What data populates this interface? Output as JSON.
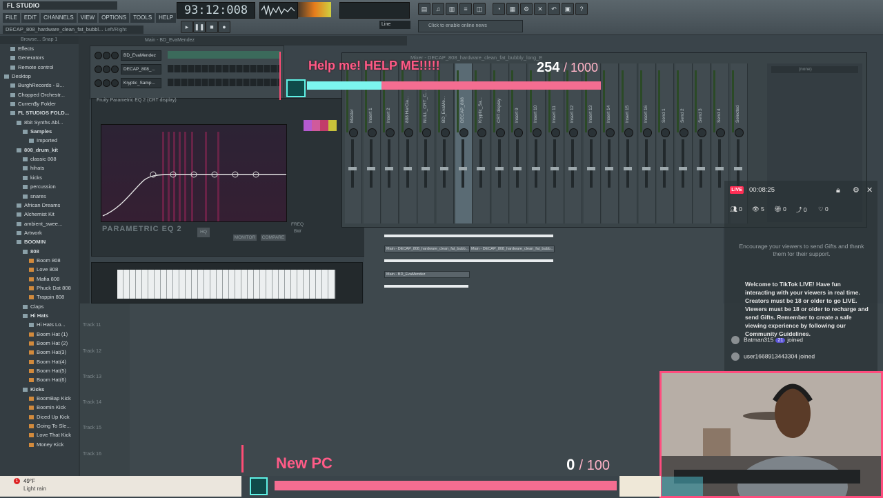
{
  "app": {
    "logo": "FL STUDIO",
    "menus": [
      "FILE",
      "EDIT",
      "CHANNELS",
      "VIEW",
      "OPTIONS",
      "TOOLS",
      "HELP"
    ],
    "hint": "DECAP_808_hardware_clean_fat_bubbl...",
    "hint_right": "Left/Right",
    "time": "93:12:008",
    "line_mode": "Line",
    "news": "Click to enable online news"
  },
  "browser": {
    "header": "Browse... Snap 1",
    "items": [
      {
        "label": "Effects",
        "indent": 1,
        "icon": "folder"
      },
      {
        "label": "Generators",
        "indent": 1,
        "icon": "folder"
      },
      {
        "label": "Remote control",
        "indent": 1,
        "icon": "folder"
      },
      {
        "label": "Desktop",
        "indent": 0,
        "icon": "folder"
      },
      {
        "label": "BurghRecords - B...",
        "indent": 1,
        "icon": "folder"
      },
      {
        "label": "Chopped Orchestr...",
        "indent": 1,
        "icon": "folder"
      },
      {
        "label": "Curren$y Folder",
        "indent": 1,
        "icon": "folder"
      },
      {
        "label": "FL STUDIOS FOLD...",
        "indent": 1,
        "icon": "folder",
        "bold": true
      },
      {
        "label": "8bit Synths Abl...",
        "indent": 2,
        "icon": "folder"
      },
      {
        "label": "Samples",
        "indent": 3,
        "icon": "folder",
        "bold": true
      },
      {
        "label": "Imported",
        "indent": 4,
        "icon": "folder"
      },
      {
        "label": "808_drum_kit",
        "indent": 2,
        "icon": "folder",
        "bold": true
      },
      {
        "label": "classic 808",
        "indent": 3,
        "icon": "folder"
      },
      {
        "label": "hihats",
        "indent": 3,
        "icon": "folder"
      },
      {
        "label": "kicks",
        "indent": 3,
        "icon": "folder"
      },
      {
        "label": "percussion",
        "indent": 3,
        "icon": "folder"
      },
      {
        "label": "snares",
        "indent": 3,
        "icon": "folder"
      },
      {
        "label": "African Dreams",
        "indent": 2,
        "icon": "folder"
      },
      {
        "label": "Alchemist Kit",
        "indent": 2,
        "icon": "folder"
      },
      {
        "label": "ambient_swee...",
        "indent": 2,
        "icon": "folder"
      },
      {
        "label": "Artwork",
        "indent": 2,
        "icon": "folder"
      },
      {
        "label": "BOOMIN",
        "indent": 2,
        "icon": "folder",
        "bold": true
      },
      {
        "label": "808",
        "indent": 3,
        "icon": "folder",
        "bold": true
      },
      {
        "label": "Boom 808",
        "indent": 4,
        "icon": "sample"
      },
      {
        "label": "Love 808",
        "indent": 4,
        "icon": "sample"
      },
      {
        "label": "Mafia 808",
        "indent": 4,
        "icon": "sample"
      },
      {
        "label": "Phuck Dat 808",
        "indent": 4,
        "icon": "sample"
      },
      {
        "label": "Trappin 808",
        "indent": 4,
        "icon": "sample"
      },
      {
        "label": "Claps",
        "indent": 3,
        "icon": "folder"
      },
      {
        "label": "Hi Hats",
        "indent": 3,
        "icon": "folder",
        "bold": true
      },
      {
        "label": "Hi Hats Lo...",
        "indent": 4,
        "icon": "folder"
      },
      {
        "label": "Boom Hat (1)",
        "indent": 4,
        "icon": "sample"
      },
      {
        "label": "Boom Hat (2)",
        "indent": 4,
        "icon": "sample"
      },
      {
        "label": "Boom Hat(3)",
        "indent": 4,
        "icon": "sample"
      },
      {
        "label": "Boom Hat(4)",
        "indent": 4,
        "icon": "sample"
      },
      {
        "label": "Boom Hat(5)",
        "indent": 4,
        "icon": "sample"
      },
      {
        "label": "Boom Hat(6)",
        "indent": 4,
        "icon": "sample"
      },
      {
        "label": "Kicks",
        "indent": 3,
        "icon": "folder",
        "bold": true
      },
      {
        "label": "BoomBap Kick",
        "indent": 4,
        "icon": "sample"
      },
      {
        "label": "Boomin Kick",
        "indent": 4,
        "icon": "sample"
      },
      {
        "label": "Diced Up Kick",
        "indent": 4,
        "icon": "sample"
      },
      {
        "label": "Going To Sle...",
        "indent": 4,
        "icon": "sample"
      },
      {
        "label": "Love That Kick",
        "indent": 4,
        "icon": "sample"
      },
      {
        "label": "Money Kick",
        "indent": 4,
        "icon": "sample"
      }
    ]
  },
  "rack": {
    "title": "Main - BD_EvaMendez",
    "channels": [
      "BD_EvaMendez",
      "DECAP_808_...",
      "Kryptic_Samp..."
    ]
  },
  "eq": {
    "title": "Fruity Parametric EQ 2 (CRT display)",
    "logo": "PARAMETRIC EQ 2",
    "buttons": [
      "HQ",
      "MONITOR",
      "COMPARE"
    ],
    "labels": [
      "FREQ",
      "BW"
    ]
  },
  "mixer": {
    "title": "Mixer - DECAP_808_hardware_clean_fat_bubbly_long_E",
    "strips": [
      "Master",
      "Insert 1",
      "Insert 2",
      "808 HarCla...",
      "NULL_CRT_C...",
      "BD_EvaMe...",
      "DECAP_808",
      "Kryptic_Sa...",
      "CRT display",
      "Insert 9",
      "Insert 10",
      "Insert 11",
      "Insert 12",
      "Insert 13",
      "Insert 14",
      "Insert 15",
      "Insert 16",
      "Send 1",
      "Send 2",
      "Send 3",
      "Send 4",
      "Selected"
    ],
    "active_strip": "DECAP_808",
    "slot": "(none)"
  },
  "playlist": {
    "tracks": [
      "Track 11",
      "Track 12",
      "Track 13",
      "Track 14",
      "Track 15",
      "Track 16"
    ],
    "clips": [
      {
        "label": "Main - DECAP_808_hardware_clean_fat_bubb..."
      },
      {
        "label": "Main - DECAP_808_hardware_clean_fat_bubb..."
      },
      {
        "label": "Main - BD_EvaMendez"
      }
    ]
  },
  "goal_top": {
    "title": "Help me! HELP ME!!!!!",
    "current": "254",
    "max": "1000",
    "progress": 0.254
  },
  "goal_bottom": {
    "title": "New PC",
    "current": "0",
    "max": "100",
    "progress": 0.0
  },
  "live": {
    "badge": "LIVE",
    "time": "00:08:25",
    "stats": {
      "viewers": "0",
      "people": "5",
      "gifts": "0",
      "shares": "0",
      "likes": "0"
    },
    "encourage": "Encourage your viewers to send Gifts and thank them for their support.",
    "welcome": "Welcome to TikTok LIVE! Have fun interacting with your viewers in real time. Creators must be 18 or older to go LIVE. Viewers must be 18 or older to recharge and send Gifts. Remember to create a safe viewing experience by following our Community Guidelines.",
    "joins": [
      {
        "user": "Batman315",
        "level": "21",
        "action": "joined"
      },
      {
        "user": "user1668913443304",
        "action": "joined"
      }
    ]
  },
  "weather": {
    "temp": "49°F",
    "desc": "Light rain",
    "alert": "1"
  },
  "colors": {
    "goal_pink": "#ff5b87",
    "goal_cyan": "#7cf5ef",
    "live_red": "#ff2e55",
    "cam_border": "#ff4d7e"
  }
}
